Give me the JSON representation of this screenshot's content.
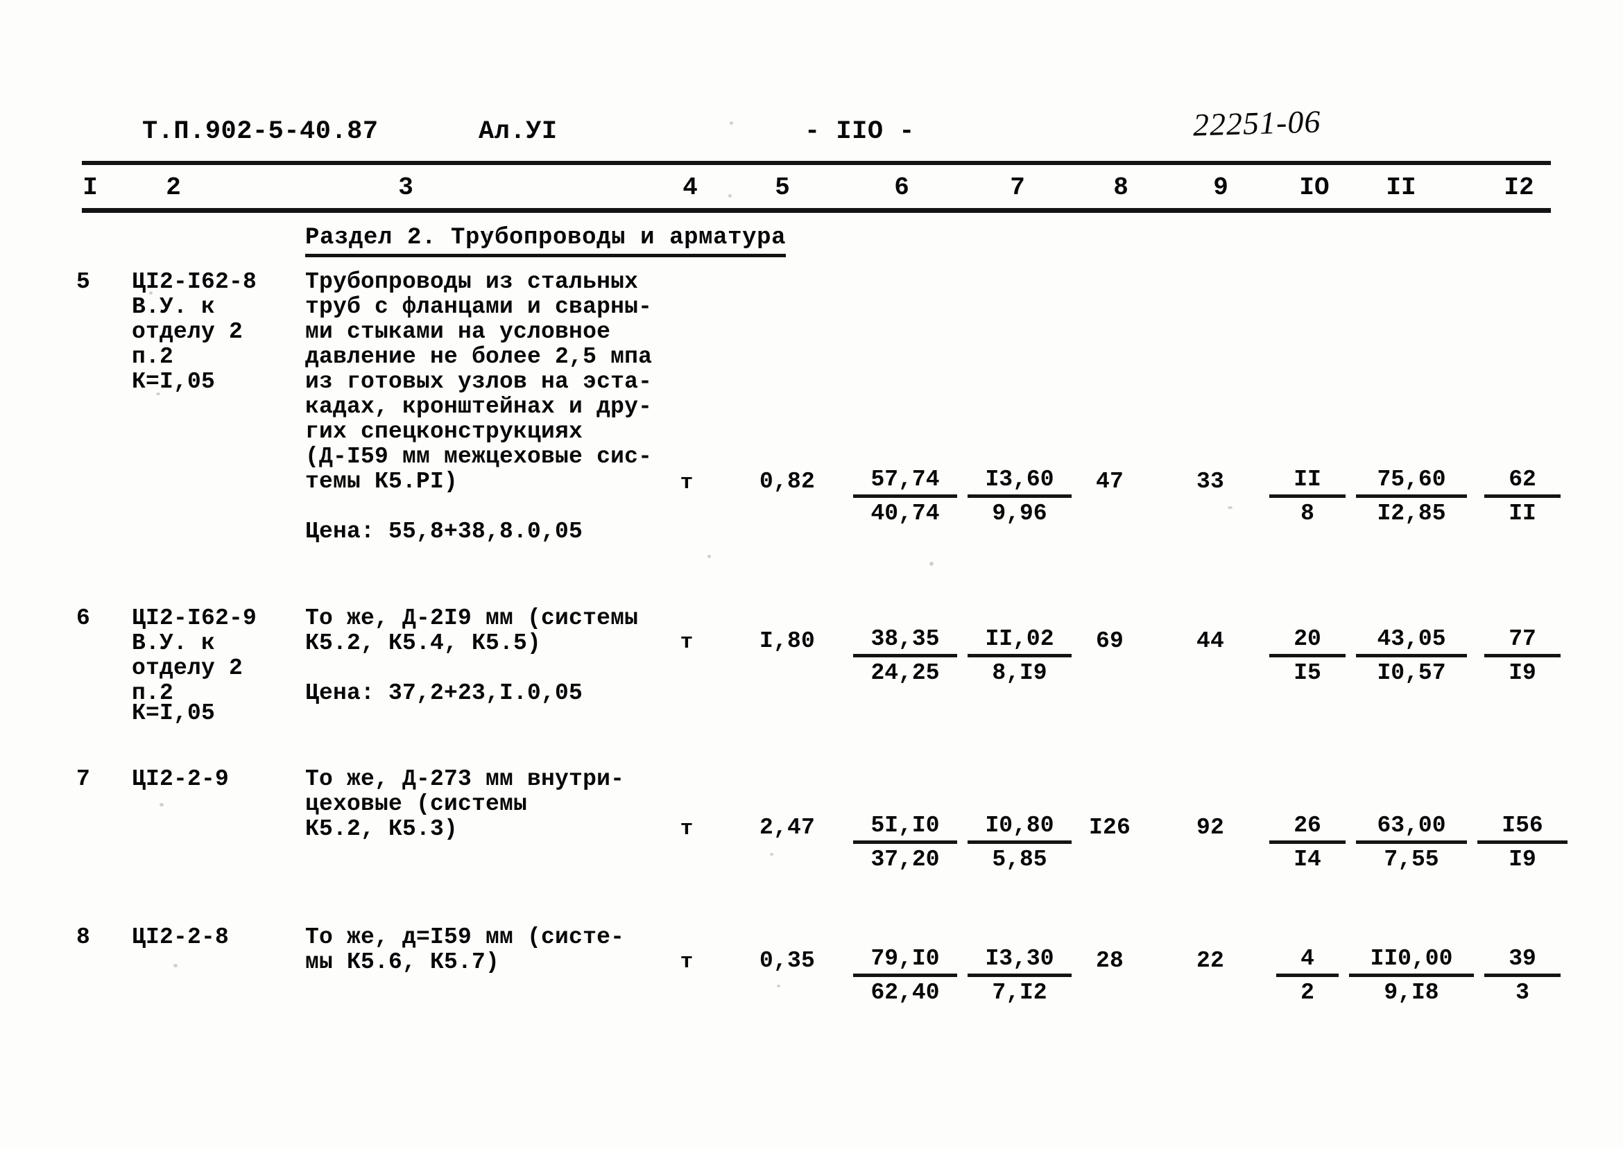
{
  "header": {
    "doc_code": "Т.П.902-5-40.87",
    "album": "Ал.УI",
    "page_number": "- IIO -",
    "stamp": "22251-06"
  },
  "table": {
    "column_numbers": [
      "I",
      "2",
      "3",
      "4",
      "5",
      "6",
      "7",
      "8",
      "9",
      "IO",
      "II",
      "I2"
    ],
    "section_title": "Раздел 2. Трубопроводы и арматура",
    "rows": [
      {
        "no": "5",
        "code_lines": [
          "ЦI2-I62-8",
          "В.У. к",
          "отделу 2",
          "п.2",
          "К=I,05"
        ],
        "description_lines": [
          "Трубопроводы из стальных",
          "труб с фланцами и сварны-",
          "ми стыками на условное",
          "давление не более 2,5 мпа",
          "из готовых узлов на эста-",
          "кадах, кронштейнах и дру-",
          "гих спецконструкциях",
          "(Д-I59 мм межцеховые сис-",
          "темы К5.РI)"
        ],
        "price_note": "Цена: 55,8+38,8.0,05",
        "unit": "т",
        "qty": "0,82",
        "col6_top": "57,74",
        "col6_bot": "40,74",
        "col7_top": "I3,60",
        "col7_bot": "9,96",
        "col8": "47",
        "col9": "33",
        "col10_top": "II",
        "col10_bot": "8",
        "col11_top": "75,60",
        "col11_bot": "I2,85",
        "col12_top": "62",
        "col12_bot": "II"
      },
      {
        "no": "6",
        "code_lines": [
          "ЦI2-I62-9",
          "В.У. к",
          "отделу 2",
          "п.2",
          "К=I,05"
        ],
        "description_lines": [
          "То же, Д-2I9 мм (системы",
          "К5.2, К5.4, К5.5)"
        ],
        "price_note": "Цена: 37,2+23,I.0,05",
        "unit": "т",
        "qty": "I,80",
        "col6_top": "38,35",
        "col6_bot": "24,25",
        "col7_top": "II,02",
        "col7_bot": "8,I9",
        "col8": "69",
        "col9": "44",
        "col10_top": "20",
        "col10_bot": "I5",
        "col11_top": "43,05",
        "col11_bot": "I0,57",
        "col12_top": "77",
        "col12_bot": "I9"
      },
      {
        "no": "7",
        "code_lines": [
          "ЦI2-2-9"
        ],
        "description_lines": [
          "То же, Д-273 мм внутри-",
          "цеховые (системы",
          "К5.2, К5.3)"
        ],
        "price_note": "",
        "unit": "т",
        "qty": "2,47",
        "col6_top": "5I,I0",
        "col6_bot": "37,20",
        "col7_top": "I0,80",
        "col7_bot": "5,85",
        "col8": "I26",
        "col9": "92",
        "col10_top": "26",
        "col10_bot": "I4",
        "col11_top": "63,00",
        "col11_bot": "7,55",
        "col12_top": "I56",
        "col12_bot": "I9"
      },
      {
        "no": "8",
        "code_lines": [
          "ЦI2-2-8"
        ],
        "description_lines": [
          "То же, д=I59 мм (систе-",
          "мы К5.6, К5.7)"
        ],
        "price_note": "",
        "unit": "т",
        "qty": "0,35",
        "col6_top": "79,I0",
        "col6_bot": "62,40",
        "col7_top": "I3,30",
        "col7_bot": "7,I2",
        "col8": "28",
        "col9": "22",
        "col10_top": "4",
        "col10_bot": "2",
        "col11_top": "II0,00",
        "col11_bot": "9,I8",
        "col12_top": "39",
        "col12_bot": "3"
      }
    ]
  }
}
